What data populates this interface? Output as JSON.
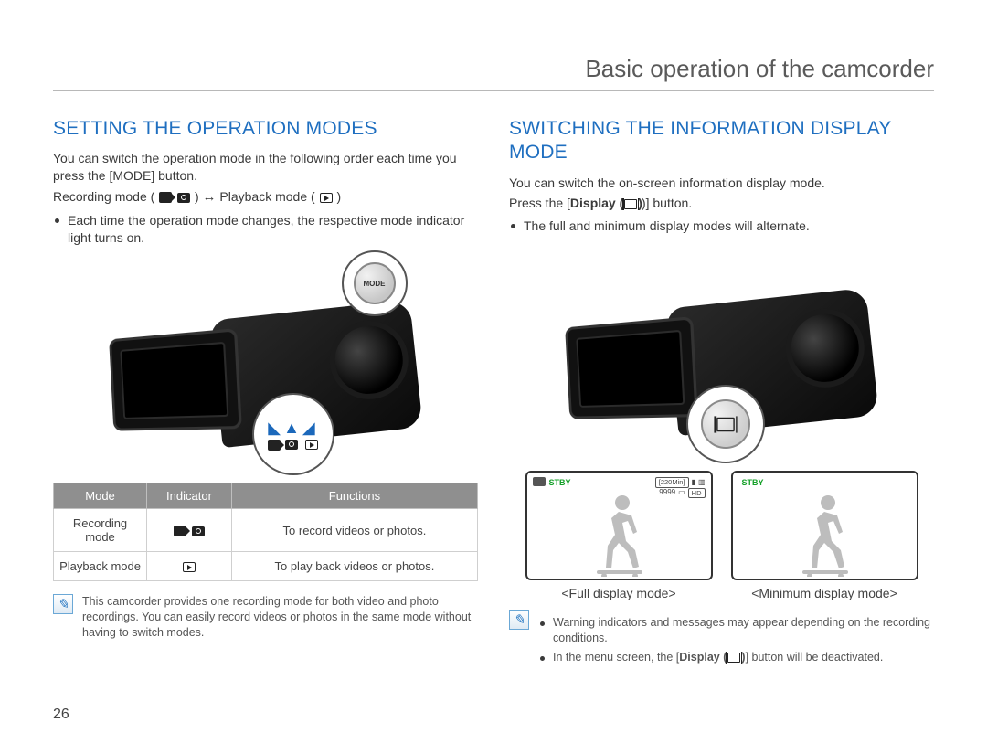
{
  "chapter_title": "Basic operation of the camcorder",
  "page_number": "26",
  "left": {
    "heading": "SETTING THE OPERATION MODES",
    "intro": "You can switch the operation mode in the following order each time you press the [MODE] button.",
    "mode_line_prefix": "Recording mode (",
    "mode_line_mid": " ) ",
    "mode_line_suffix": " Playback mode (",
    "mode_line_end": " )",
    "bullet1": "Each time the operation mode changes, the respective mode indicator light turns on.",
    "mode_button_label": "MODE",
    "table": {
      "headers": [
        "Mode",
        "Indicator",
        "Functions"
      ],
      "rows": [
        {
          "mode": "Recording mode",
          "indicator": "video_photo",
          "functions": "To record videos or photos."
        },
        {
          "mode": "Playback mode",
          "indicator": "play",
          "functions": "To play back videos or photos."
        }
      ]
    },
    "note": "This camcorder provides one recording mode for both video and photo recordings. You can easily record videos or photos in the same mode without having to switch modes."
  },
  "right": {
    "heading": "SWITCHING THE INFORMATION DISPLAY MODE",
    "intro": "You can switch the on-screen information display mode.",
    "press_line_a": "Press the [",
    "press_line_b": "Display (",
    "press_line_c": ")] button.",
    "bullet1": "The full and minimum display modes will alternate.",
    "preview_full": {
      "stby": "STBY",
      "time": "[220Min]",
      "count": "9999",
      "hd": "HD",
      "caption": "<Full display mode>"
    },
    "preview_min": {
      "stby": "STBY",
      "caption": "<Minimum display mode>"
    },
    "note_bullets": [
      "Warning indicators and messages may appear depending on the recording conditions.",
      "In the menu screen, the [Display ( |□| )] button will be deactivated."
    ],
    "note_display_word": "Display ("
  }
}
